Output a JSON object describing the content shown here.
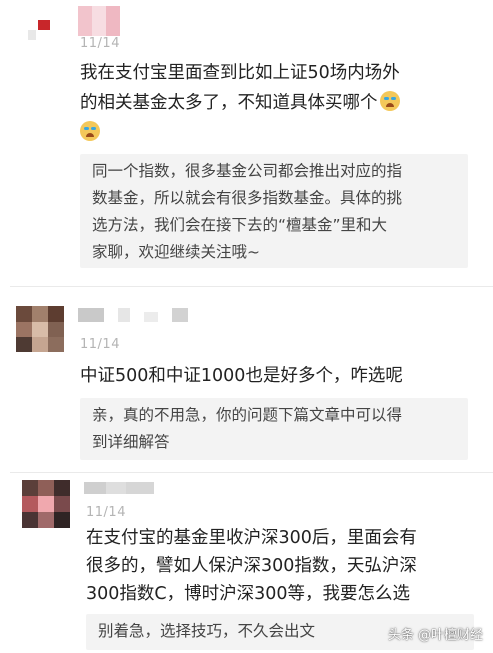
{
  "comments": [
    {
      "date": "11/14",
      "text_line1": "我在支付宝里面查到比如上证50场内场外",
      "text_line2": "的相关基金太多了，不知道具体买哪个",
      "emoji_icon": "crying-face-icon",
      "reply_lines": [
        "同一个指数，很多基金公司都会推出对应的指",
        "数基金，所以就会有很多指数基金。具体的挑",
        "选方法，我们会在接下去的“檀基金”里和大",
        "家聊，欢迎继续关注哦~"
      ]
    },
    {
      "date": "11/14",
      "text_line1": "中证500和中证1000也是好多个，咋选呢",
      "reply_lines": [
        "亲，真的不用急，你的问题下篇文章中可以得",
        "到详细解答"
      ]
    },
    {
      "date": "11/14",
      "text_lines": [
        "在支付宝的基金里收沪深300后，里面会有",
        "很多的，譬如人保沪深300指数，天弘沪深",
        "300指数C，博时沪深300等，我要怎么选"
      ],
      "reply_lines": [
        "别着急，选择技巧，不久会出文"
      ]
    }
  ],
  "watermark": "头条 @叶檀财经"
}
